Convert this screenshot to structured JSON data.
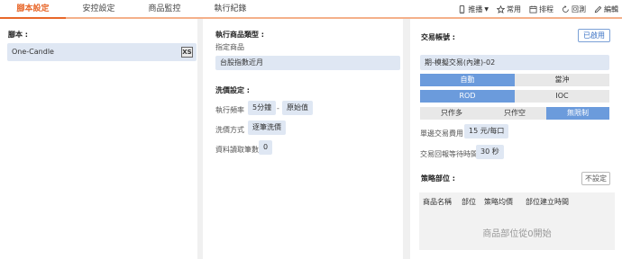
{
  "tabs": [
    "腳本設定",
    "安控設定",
    "商品監控",
    "執行紀錄"
  ],
  "tools": {
    "push": "推播",
    "frequent": "常用",
    "schedule": "排程",
    "backtest": "回測",
    "edit": "編輯"
  },
  "script_panel": {
    "heading": "腳本 :",
    "script_name": "One-Candle",
    "script_badge": "XS"
  },
  "exec_panel": {
    "type_heading": "執行商品類型 :",
    "specified_label": "指定商品",
    "product": "台股指數近月",
    "wash_heading": "洗價設定 :",
    "freq_label": "執行頻率",
    "freq_value": "5分鐘",
    "freq_sep": "-",
    "freq_mode": "原始值",
    "wash_method_label": "洗價方式",
    "wash_method_value": "逐筆洗價",
    "data_count_label": "資料讀取筆數",
    "data_count_value": "0"
  },
  "trade_panel": {
    "account_heading": "交易帳號 :",
    "enabled_button": "已啟用",
    "account": "期-模擬交易(內建)-02",
    "mode_options": [
      "自動",
      "當沖"
    ],
    "mode_selected": 0,
    "order_type_options": [
      "ROD",
      "IOC"
    ],
    "order_type_selected": 0,
    "direction_options": [
      "只作多",
      "只作空",
      "無限制"
    ],
    "direction_selected": 2,
    "fee_label": "單邊交易費用",
    "fee_value": "15 元/每口",
    "wait_label": "交易回報等待時間",
    "wait_value": "30 秒",
    "position_heading": "策略部位 :",
    "not_set_button": "不設定",
    "table_headers": [
      "商品名稱",
      "部位",
      "策略均價",
      "部位建立時間"
    ],
    "empty_message": "商品部位從0開始"
  },
  "colors": {
    "accent": "#e8672a",
    "primary": "#6b9bdc",
    "chip_bg": "#dfe7f3"
  }
}
